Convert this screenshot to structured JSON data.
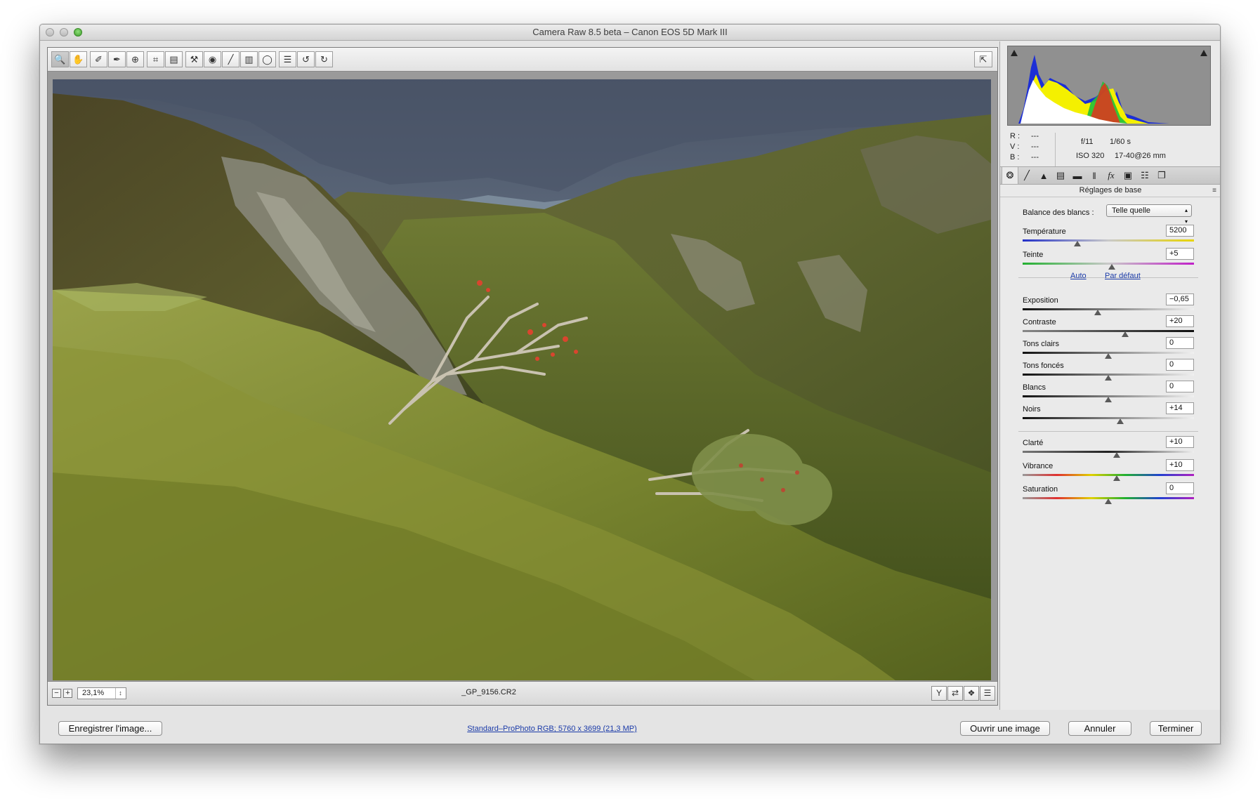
{
  "window": {
    "title": "Camera Raw 8.5 beta  –  Canon EOS 5D Mark III"
  },
  "toolbar": {
    "tools": [
      "zoom-icon",
      "hand-icon",
      "white-balance-icon",
      "color-sampler-icon",
      "target-adjust-icon",
      "crop-icon",
      "straighten-icon",
      "spot-removal-icon",
      "red-eye-icon",
      "adjustment-brush-icon",
      "graduated-filter-icon",
      "radial-filter-icon",
      "preferences-icon",
      "rotate-left-icon",
      "rotate-right-icon"
    ],
    "fullscreen_icon": "fullscreen-icon"
  },
  "status": {
    "zoom_minus": "−",
    "zoom_plus": "+",
    "zoom_value": "23,1%",
    "filename": "_GP_9156.CR2"
  },
  "readout": {
    "r_label": "R :",
    "r_value": "---",
    "v_label": "V :",
    "v_value": "---",
    "b_label": "B :",
    "b_value": "---",
    "aperture": "f/11",
    "shutter": "1/60 s",
    "iso": "ISO 320",
    "lens": "17-40@26 mm"
  },
  "panel": {
    "title": "Réglages de base",
    "white_balance_label": "Balance des blancs :",
    "white_balance_value": "Telle quelle",
    "auto_link": "Auto",
    "default_link": "Par défaut",
    "sliders": [
      {
        "key": "temperature",
        "label": "Température",
        "value": "5200",
        "level": 0.32
      },
      {
        "key": "teinte",
        "label": "Teinte",
        "value": "+5",
        "level": 0.52
      },
      {
        "key": "exposition",
        "label": "Exposition",
        "value": "−0,65",
        "level": 0.44
      },
      {
        "key": "contraste",
        "label": "Contraste",
        "value": "+20",
        "level": 0.6
      },
      {
        "key": "tons-clairs",
        "label": "Tons clairs",
        "value": "0",
        "level": 0.5
      },
      {
        "key": "tons-fonces",
        "label": "Tons foncés",
        "value": "0",
        "level": 0.5
      },
      {
        "key": "blancs",
        "label": "Blancs",
        "value": "0",
        "level": 0.5
      },
      {
        "key": "noirs",
        "label": "Noirs",
        "value": "+14",
        "level": 0.57
      },
      {
        "key": "clarte",
        "label": "Clarté",
        "value": "+10",
        "level": 0.55
      },
      {
        "key": "vibrance",
        "label": "Vibrance",
        "value": "+10",
        "level": 0.55
      },
      {
        "key": "saturation",
        "label": "Saturation",
        "value": "0",
        "level": 0.5
      }
    ]
  },
  "bottom": {
    "save_label": "Enregistrer l'image...",
    "workflow_link": "Standard–ProPhoto RGB; 5760 x 3699 (21,3 MP)",
    "open_label": "Ouvrir une image",
    "cancel_label": "Annuler",
    "done_label": "Terminer"
  },
  "colors": {
    "link": "#1a3aa8",
    "sky": "#5a6a7e",
    "grass": "#6e7a2c"
  }
}
